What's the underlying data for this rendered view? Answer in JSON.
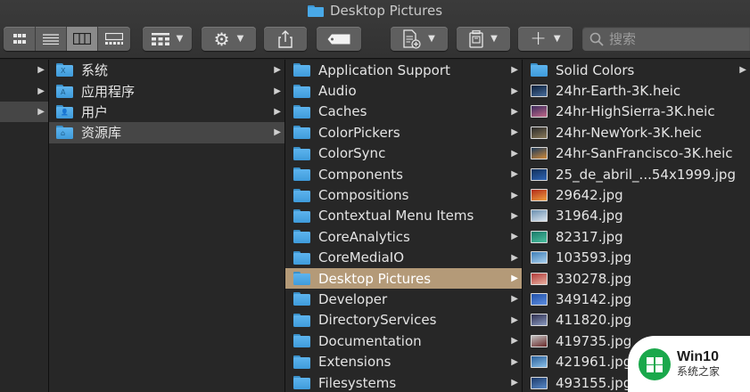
{
  "window": {
    "title": "Desktop Pictures"
  },
  "toolbar": {
    "view_modes": [
      {
        "name": "view-icons-button",
        "icon": "grid-icon"
      },
      {
        "name": "view-list-button",
        "icon": "list-icon"
      },
      {
        "name": "view-columns-button",
        "icon": "columns-icon",
        "active": true
      },
      {
        "name": "view-gallery-button",
        "icon": "gallery-icon"
      }
    ],
    "search_placeholder": "搜索"
  },
  "sidebar_col1": [
    {
      "arrow": "▶"
    },
    {
      "arrow": "▶"
    },
    {
      "arrow": "▶",
      "selected": true
    },
    {
      "arrow": ""
    }
  ],
  "col2": [
    {
      "label": "系统",
      "glyph": "X",
      "arrow": "▶"
    },
    {
      "label": "应用程序",
      "glyph": "A",
      "arrow": "▶"
    },
    {
      "label": "用户",
      "glyph": "👤",
      "arrow": "▶"
    },
    {
      "label": "资源库",
      "glyph": "⌂",
      "arrow": "▶",
      "selected": true
    }
  ],
  "col3": [
    {
      "label": "Application Support",
      "arrow": "▶"
    },
    {
      "label": "Audio",
      "arrow": "▶"
    },
    {
      "label": "Caches",
      "arrow": "▶"
    },
    {
      "label": "ColorPickers",
      "arrow": "▶"
    },
    {
      "label": "ColorSync",
      "arrow": "▶"
    },
    {
      "label": "Components",
      "arrow": "▶"
    },
    {
      "label": "Compositions",
      "arrow": "▶"
    },
    {
      "label": "Contextual Menu Items",
      "arrow": "▶"
    },
    {
      "label": "CoreAnalytics",
      "arrow": "▶"
    },
    {
      "label": "CoreMediaIO",
      "arrow": "▶"
    },
    {
      "label": "Desktop Pictures",
      "arrow": "▶",
      "selected": true
    },
    {
      "label": "Developer",
      "arrow": "▶"
    },
    {
      "label": "DirectoryServices",
      "arrow": "▶"
    },
    {
      "label": "Documentation",
      "arrow": "▶"
    },
    {
      "label": "Extensions",
      "arrow": "▶"
    },
    {
      "label": "Filesystems",
      "arrow": "▶"
    }
  ],
  "col4": [
    {
      "label": "Solid Colors",
      "kind": "folder",
      "arrow": "▶"
    },
    {
      "label": "24hr-Earth-3K.heic",
      "kind": "image",
      "colors": [
        "#0b1f3a",
        "#4a6e9c"
      ]
    },
    {
      "label": "24hr-HighSierra-3K.heic",
      "kind": "image",
      "colors": [
        "#3b2a5c",
        "#c06a8a"
      ]
    },
    {
      "label": "24hr-NewYork-3K.heic",
      "kind": "image",
      "colors": [
        "#2a2a2a",
        "#8a7a5a"
      ]
    },
    {
      "label": "24hr-SanFrancisco-3K.heic",
      "kind": "image",
      "colors": [
        "#1d3a5a",
        "#d08a3a"
      ]
    },
    {
      "label": "25_de_abril_...54x1999.jpg",
      "kind": "image",
      "colors": [
        "#12305a",
        "#2f65b5"
      ]
    },
    {
      "label": "29642.jpg",
      "kind": "image",
      "colors": [
        "#b22a1a",
        "#f0a040"
      ]
    },
    {
      "label": "31964.jpg",
      "kind": "image",
      "colors": [
        "#6a8fb0",
        "#d9e4ee"
      ]
    },
    {
      "label": "82317.jpg",
      "kind": "image",
      "colors": [
        "#1a7a6a",
        "#4cc0a0"
      ]
    },
    {
      "label": "103593.jpg",
      "kind": "image",
      "colors": [
        "#3f7fb8",
        "#a9d0ee"
      ]
    },
    {
      "label": "330278.jpg",
      "kind": "image",
      "colors": [
        "#b23a3a",
        "#e8b0a0"
      ]
    },
    {
      "label": "349142.jpg",
      "kind": "image",
      "colors": [
        "#1f4fa8",
        "#5f8fe0"
      ]
    },
    {
      "label": "411820.jpg",
      "kind": "image",
      "colors": [
        "#2f2f4f",
        "#8a9ac0"
      ]
    },
    {
      "label": "419735.jpg",
      "kind": "image",
      "colors": [
        "#c0c0c0",
        "#6a2a2a"
      ]
    },
    {
      "label": "421961.jpg",
      "kind": "image",
      "colors": [
        "#2a5f9a",
        "#8ac0e8"
      ]
    },
    {
      "label": "493155.jpg",
      "kind": "image",
      "colors": [
        "#1c3a6a",
        "#5a8ac8"
      ]
    }
  ],
  "watermark": {
    "line1": "Win10",
    "line2": "系统之家"
  }
}
